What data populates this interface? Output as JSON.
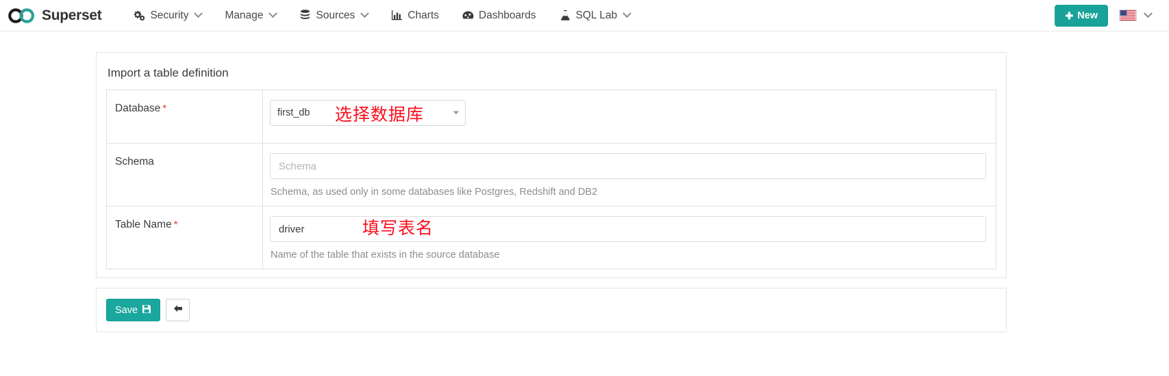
{
  "navbar": {
    "brand": "Superset",
    "brand_logo_icon": "infinity-logo-icon",
    "items": [
      {
        "label": "Security",
        "icon": "gears-icon",
        "has_caret": true
      },
      {
        "label": "Manage",
        "icon": "",
        "has_caret": true
      },
      {
        "label": "Sources",
        "icon": "database-icon",
        "has_caret": true
      },
      {
        "label": "Charts",
        "icon": "bar-chart-icon",
        "has_caret": false
      },
      {
        "label": "Dashboards",
        "icon": "dashboard-icon",
        "has_caret": false
      },
      {
        "label": "SQL Lab",
        "icon": "flask-icon",
        "has_caret": true
      }
    ],
    "new_button": {
      "label": "New",
      "icon": "plus-icon",
      "color": "#18a299"
    },
    "language": {
      "flag": "us-flag-icon",
      "has_caret": true
    }
  },
  "panel": {
    "title": "Import a table definition",
    "fields": {
      "database": {
        "label": "Database",
        "required_marker": "*",
        "selected_value": "first_db",
        "annotation": "选择数据库"
      },
      "schema": {
        "label": "Schema",
        "value": "",
        "placeholder": "Schema",
        "help": "Schema, as used only in some databases like Postgres, Redshift and DB2"
      },
      "table_name": {
        "label": "Table Name",
        "required_marker": "*",
        "value": "driver",
        "help": "Name of the table that exists in the source database",
        "annotation": "填写表名"
      }
    }
  },
  "actions": {
    "save": {
      "label": "Save",
      "icon": "floppy-disk-icon",
      "color": "#1aa79e"
    },
    "back": {
      "icon": "arrow-left-icon"
    }
  },
  "colors": {
    "accent_teal": "#18a299",
    "annotation_red": "#fc0d1c",
    "required_red": "#e2392c"
  }
}
